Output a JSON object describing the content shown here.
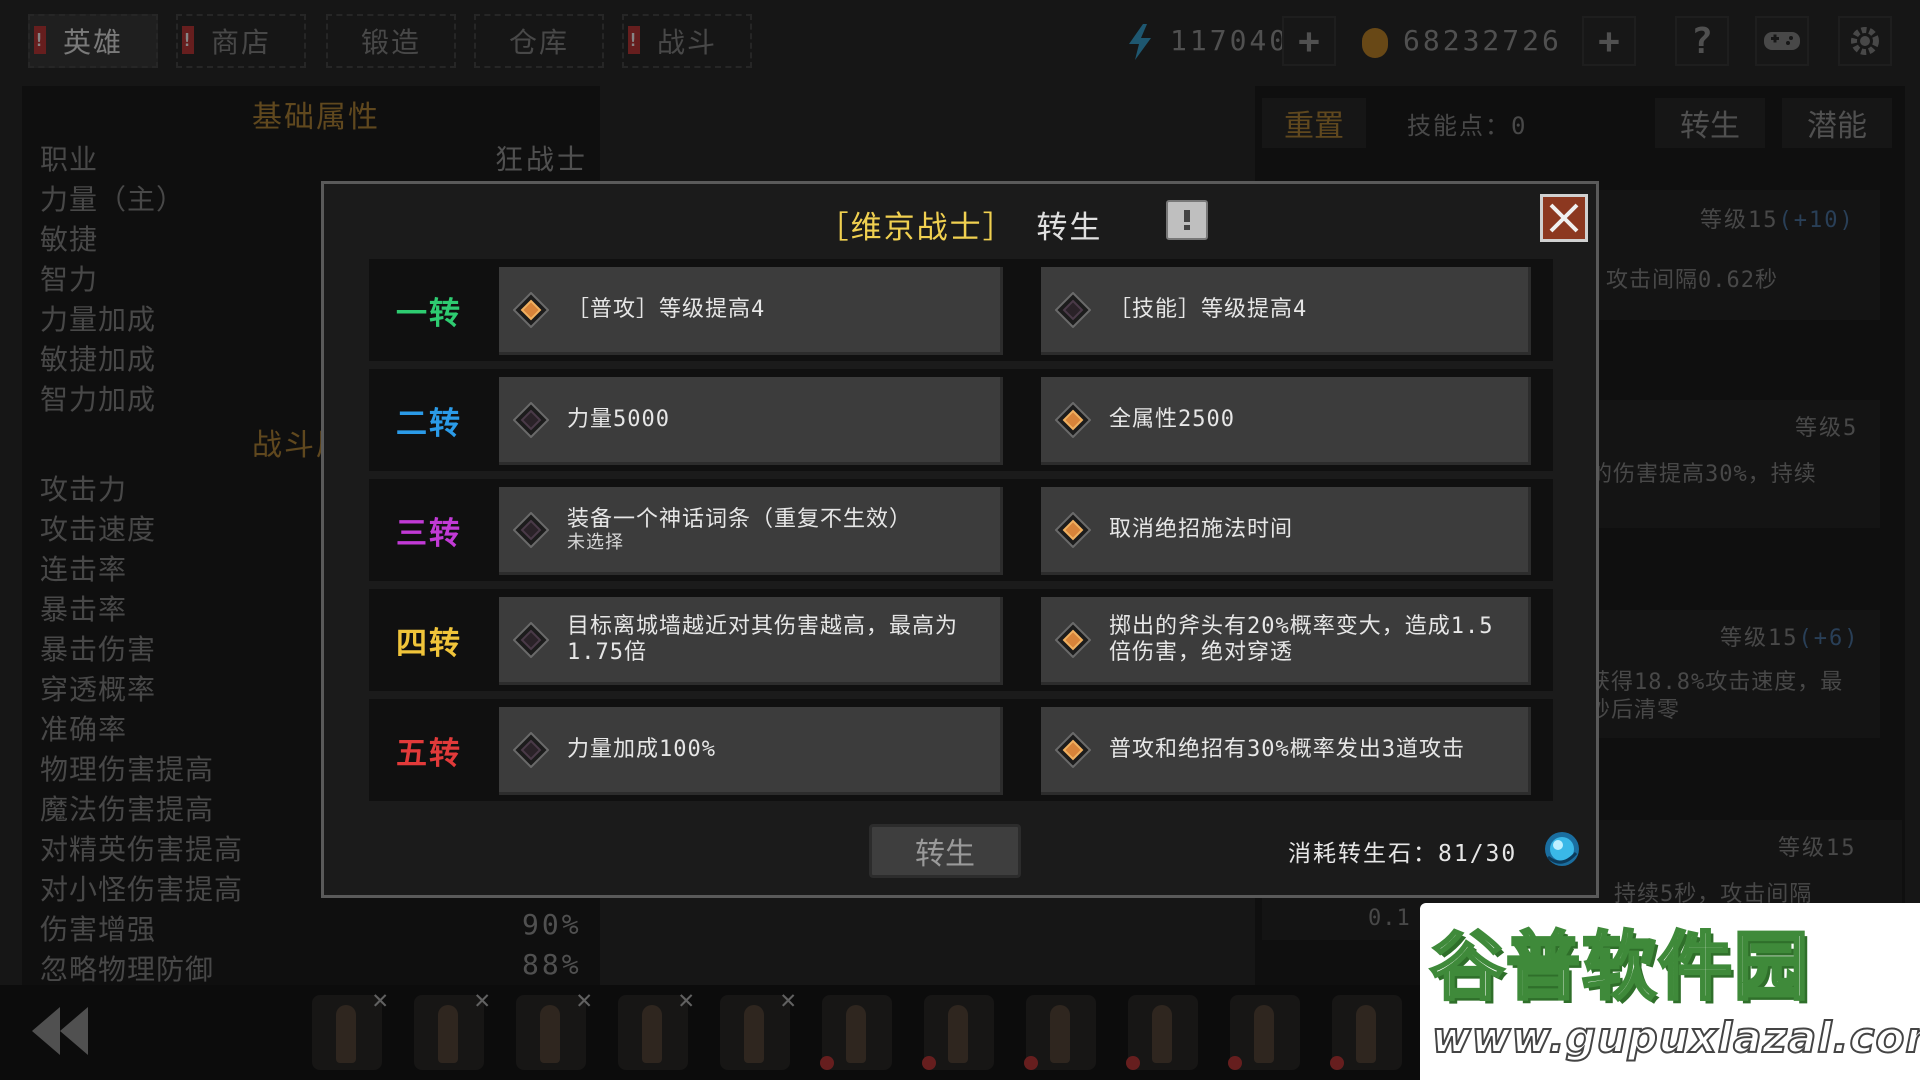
{
  "top_tabs": [
    {
      "label": "英雄",
      "active": true,
      "alert": true
    },
    {
      "label": "商店",
      "active": false,
      "alert": true
    },
    {
      "label": "锻造",
      "active": false,
      "alert": false
    },
    {
      "label": "仓库",
      "active": false,
      "alert": false
    },
    {
      "label": "战斗",
      "active": false,
      "alert": true
    }
  ],
  "resources": {
    "energy": "117040",
    "gold": "68232726"
  },
  "left_panel": {
    "basic_title": "基础属性",
    "class_label": "职业",
    "class_value": "狂战士",
    "basic_attrs": [
      "力量（主）",
      "敏捷",
      "智力",
      "力量加成",
      "敏捷加成",
      "智力加成"
    ],
    "combat_title": "战斗属",
    "combat_attrs": [
      "攻击力",
      "攻击速度",
      "连击率",
      "暴击率",
      "暴击伤害",
      "穿透概率",
      "准确率",
      "物理伤害提高",
      "魔法伤害提高",
      "对精英伤害提高",
      "对小怪伤害提高",
      "伤害增强",
      "忽略物理防御"
    ],
    "visible_values": {
      "damage_boost": "90%",
      "ignore_phys_def": "88%"
    }
  },
  "right_panel": {
    "reset_label": "重置",
    "skill_points": "技能点：0",
    "tab_rebirth": "转生",
    "tab_potential": "潜能",
    "cards": [
      {
        "level": "等级15",
        "bonus": "(+10)",
        "text": "攻击间隔0.62秒"
      },
      {
        "level": "等级5",
        "bonus": "",
        "text": "的伤害提高30%，持续"
      },
      {
        "level": "等级15",
        "bonus": "(+6)",
        "text": "获得18.8%攻击速度，最",
        "text2": "秒后清零"
      },
      {
        "level": "等级15",
        "bonus": "",
        "text": "持续5秒，攻击间隔",
        "text2": "0.1"
      }
    ]
  },
  "modal": {
    "title_hero": "［维京战士］",
    "title_action": "转生",
    "tiers": [
      {
        "label": "一转",
        "color": "#2ecc71",
        "left": {
          "text": "［普攻］等级提高4",
          "sub": "",
          "selected": true
        },
        "right": {
          "text": "［技能］等级提高4",
          "sub": "",
          "selected": false
        }
      },
      {
        "label": "二转",
        "color": "#2b9be8",
        "left": {
          "text": "力量5000",
          "sub": "",
          "selected": false
        },
        "right": {
          "text": "全属性2500",
          "sub": "",
          "selected": true
        }
      },
      {
        "label": "三转",
        "color": "#c23ad6",
        "left": {
          "text": "装备一个神话词条（重复不生效）",
          "sub": "未选择",
          "selected": false
        },
        "right": {
          "text": "取消绝招施法时间",
          "sub": "",
          "selected": true
        }
      },
      {
        "label": "四转",
        "color": "#f0c43a",
        "left": {
          "text": "目标离城墙越近对其伤害越高，最高为1.75倍",
          "sub": "",
          "selected": false
        },
        "right": {
          "text": "掷出的斧头有20%概率变大，造成1.5倍伤害，绝对穿透",
          "sub": "",
          "selected": true
        }
      },
      {
        "label": "五转",
        "color": "#e23a3a",
        "left": {
          "text": "力量加成100%",
          "sub": "",
          "selected": false
        },
        "right": {
          "text": "普攻和绝招有30%概率发出3道攻击",
          "sub": "",
          "selected": true
        }
      }
    ],
    "rebirth_button": "转生",
    "cost_label": "消耗转生石：",
    "cost_value": "81/30"
  },
  "watermark": {
    "title": "谷普软件园",
    "url": "www.gupuxlazal.com"
  },
  "colors": {
    "accent_gold": "#f0d050",
    "diamond_orange": "#d8843a",
    "close_bg": "#8c3820"
  }
}
